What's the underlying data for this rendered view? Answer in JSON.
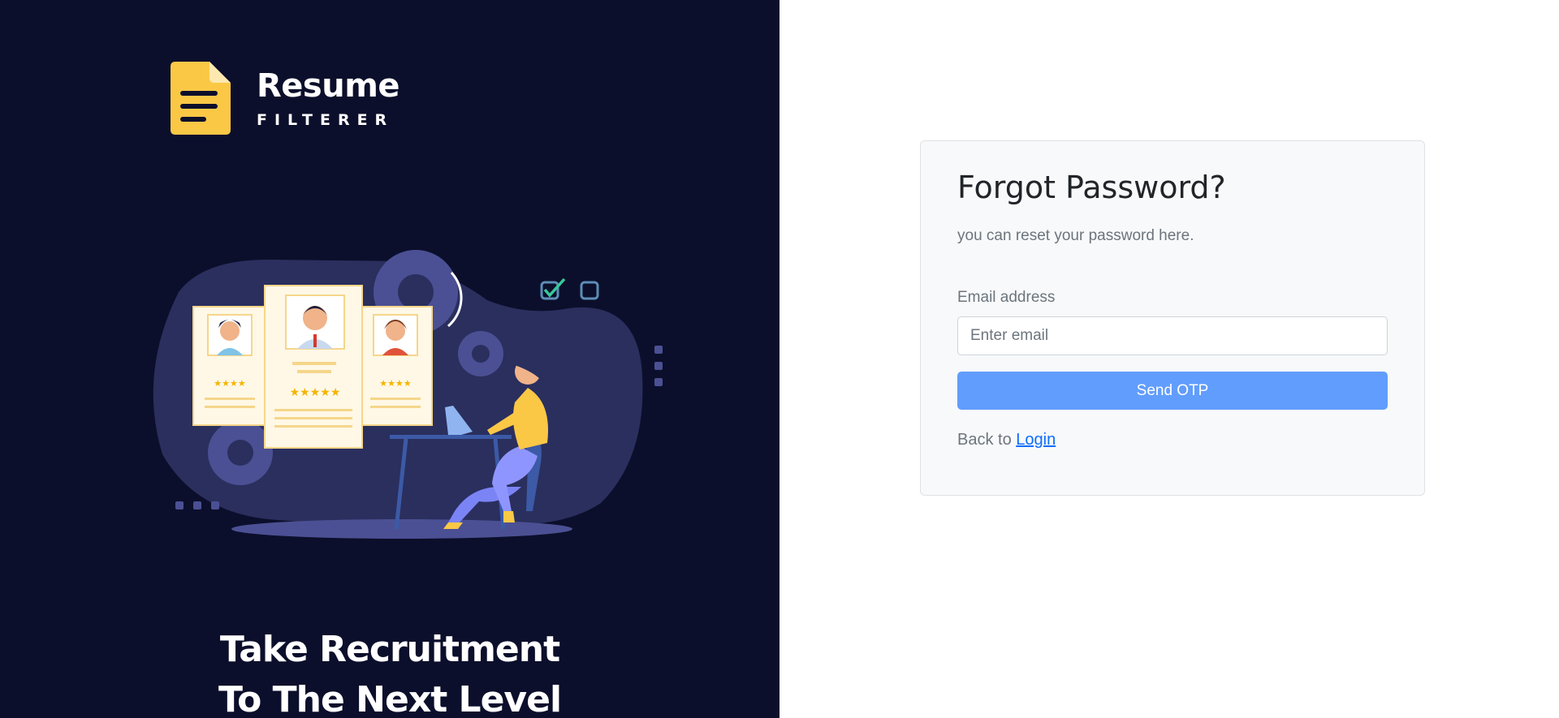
{
  "brand": {
    "name": "Resume",
    "subtitle": "FILTERER",
    "logo_icon": "document-icon",
    "accent": "#fbc846"
  },
  "hero": {
    "tagline_line1": "Take Recruitment",
    "tagline_line2": "To The Next Level",
    "illustration": "recruiter-reviewing-resumes-illustration"
  },
  "form": {
    "title": "Forgot Password?",
    "subtitle": "you can reset your password here.",
    "email_label": "Email address",
    "email_placeholder": "Enter email",
    "email_value": "",
    "submit_label": "Send OTP",
    "back_prefix": "Back to",
    "login_link": "Login"
  },
  "colors": {
    "left_background": "#0c0f2b",
    "button": "#619dfc",
    "link": "#0d6efd"
  }
}
